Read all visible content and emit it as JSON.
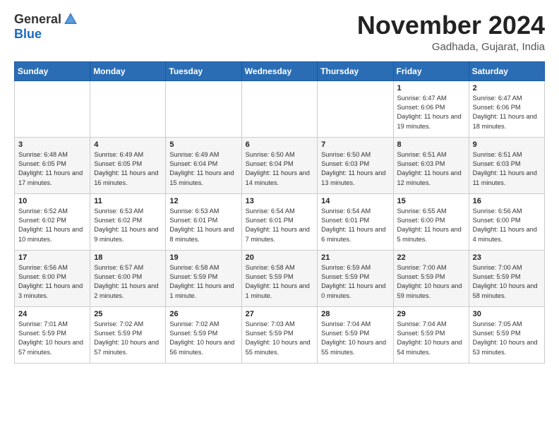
{
  "header": {
    "logo_general": "General",
    "logo_blue": "Blue",
    "month_title": "November 2024",
    "location": "Gadhada, Gujarat, India"
  },
  "weekdays": [
    "Sunday",
    "Monday",
    "Tuesday",
    "Wednesday",
    "Thursday",
    "Friday",
    "Saturday"
  ],
  "weeks": [
    [
      {
        "day": "",
        "info": ""
      },
      {
        "day": "",
        "info": ""
      },
      {
        "day": "",
        "info": ""
      },
      {
        "day": "",
        "info": ""
      },
      {
        "day": "",
        "info": ""
      },
      {
        "day": "1",
        "info": "Sunrise: 6:47 AM\nSunset: 6:06 PM\nDaylight: 11 hours and 19 minutes."
      },
      {
        "day": "2",
        "info": "Sunrise: 6:47 AM\nSunset: 6:06 PM\nDaylight: 11 hours and 18 minutes."
      }
    ],
    [
      {
        "day": "3",
        "info": "Sunrise: 6:48 AM\nSunset: 6:05 PM\nDaylight: 11 hours and 17 minutes."
      },
      {
        "day": "4",
        "info": "Sunrise: 6:49 AM\nSunset: 6:05 PM\nDaylight: 11 hours and 16 minutes."
      },
      {
        "day": "5",
        "info": "Sunrise: 6:49 AM\nSunset: 6:04 PM\nDaylight: 11 hours and 15 minutes."
      },
      {
        "day": "6",
        "info": "Sunrise: 6:50 AM\nSunset: 6:04 PM\nDaylight: 11 hours and 14 minutes."
      },
      {
        "day": "7",
        "info": "Sunrise: 6:50 AM\nSunset: 6:03 PM\nDaylight: 11 hours and 13 minutes."
      },
      {
        "day": "8",
        "info": "Sunrise: 6:51 AM\nSunset: 6:03 PM\nDaylight: 11 hours and 12 minutes."
      },
      {
        "day": "9",
        "info": "Sunrise: 6:51 AM\nSunset: 6:03 PM\nDaylight: 11 hours and 11 minutes."
      }
    ],
    [
      {
        "day": "10",
        "info": "Sunrise: 6:52 AM\nSunset: 6:02 PM\nDaylight: 11 hours and 10 minutes."
      },
      {
        "day": "11",
        "info": "Sunrise: 6:53 AM\nSunset: 6:02 PM\nDaylight: 11 hours and 9 minutes."
      },
      {
        "day": "12",
        "info": "Sunrise: 6:53 AM\nSunset: 6:01 PM\nDaylight: 11 hours and 8 minutes."
      },
      {
        "day": "13",
        "info": "Sunrise: 6:54 AM\nSunset: 6:01 PM\nDaylight: 11 hours and 7 minutes."
      },
      {
        "day": "14",
        "info": "Sunrise: 6:54 AM\nSunset: 6:01 PM\nDaylight: 11 hours and 6 minutes."
      },
      {
        "day": "15",
        "info": "Sunrise: 6:55 AM\nSunset: 6:00 PM\nDaylight: 11 hours and 5 minutes."
      },
      {
        "day": "16",
        "info": "Sunrise: 6:56 AM\nSunset: 6:00 PM\nDaylight: 11 hours and 4 minutes."
      }
    ],
    [
      {
        "day": "17",
        "info": "Sunrise: 6:56 AM\nSunset: 6:00 PM\nDaylight: 11 hours and 3 minutes."
      },
      {
        "day": "18",
        "info": "Sunrise: 6:57 AM\nSunset: 6:00 PM\nDaylight: 11 hours and 2 minutes."
      },
      {
        "day": "19",
        "info": "Sunrise: 6:58 AM\nSunset: 5:59 PM\nDaylight: 11 hours and 1 minute."
      },
      {
        "day": "20",
        "info": "Sunrise: 6:58 AM\nSunset: 5:59 PM\nDaylight: 11 hours and 1 minute."
      },
      {
        "day": "21",
        "info": "Sunrise: 6:59 AM\nSunset: 5:59 PM\nDaylight: 11 hours and 0 minutes."
      },
      {
        "day": "22",
        "info": "Sunrise: 7:00 AM\nSunset: 5:59 PM\nDaylight: 10 hours and 59 minutes."
      },
      {
        "day": "23",
        "info": "Sunrise: 7:00 AM\nSunset: 5:59 PM\nDaylight: 10 hours and 58 minutes."
      }
    ],
    [
      {
        "day": "24",
        "info": "Sunrise: 7:01 AM\nSunset: 5:59 PM\nDaylight: 10 hours and 57 minutes."
      },
      {
        "day": "25",
        "info": "Sunrise: 7:02 AM\nSunset: 5:59 PM\nDaylight: 10 hours and 57 minutes."
      },
      {
        "day": "26",
        "info": "Sunrise: 7:02 AM\nSunset: 5:59 PM\nDaylight: 10 hours and 56 minutes."
      },
      {
        "day": "27",
        "info": "Sunrise: 7:03 AM\nSunset: 5:59 PM\nDaylight: 10 hours and 55 minutes."
      },
      {
        "day": "28",
        "info": "Sunrise: 7:04 AM\nSunset: 5:59 PM\nDaylight: 10 hours and 55 minutes."
      },
      {
        "day": "29",
        "info": "Sunrise: 7:04 AM\nSunset: 5:59 PM\nDaylight: 10 hours and 54 minutes."
      },
      {
        "day": "30",
        "info": "Sunrise: 7:05 AM\nSunset: 5:59 PM\nDaylight: 10 hours and 53 minutes."
      }
    ]
  ]
}
